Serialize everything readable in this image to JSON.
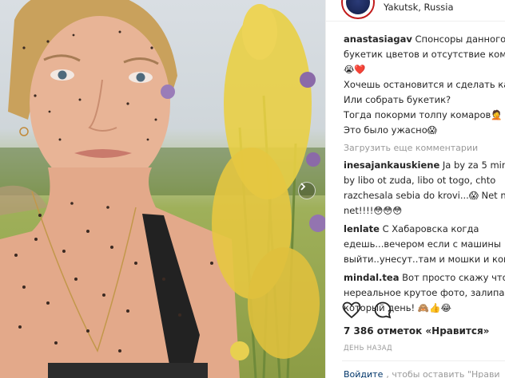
{
  "header": {
    "location": "Yakutsk, Russia"
  },
  "comments": [
    {
      "user": "anastasiagav",
      "text": "Спонсоры данного ф\nбукетик цветов и отсутствие комар\n😭❤️\nХочешь остановится и сделать кад\nИли собрать букетик?\nТогда покорми толпу комаров🤦 \nЭто было ужасно😱"
    }
  ],
  "load_more": "Загрузить еще комментарии",
  "replies": [
    {
      "user": "inesajankauskiene",
      "text": "Ja by za 5 min u\nby libo ot zuda, libo ot togo, chto\nrazchesala sebia do krovi...😱 Net n\nnet!!!!😳😳😳"
    },
    {
      "user": "lenlate",
      "text": "С Хабаровска когда\nедешь...вечером если с машины\nвыйти..унесут..там и мошки и кома"
    },
    {
      "user": "mindal.tea",
      "text": "Вот просто скажу что\nнереальное крутое фото, залипаю\nкоторый день! 🙈👍😂"
    }
  ],
  "actions": {
    "like_icon": "heart-outline-icon",
    "comment_icon": "comment-bubble-icon"
  },
  "likes_text": "7 386 отметок «Нравится»",
  "date_text": "ДЕНЬ НАЗАД",
  "login": {
    "link": "Войдите",
    "text": ", чтобы оставить \"Нрави"
  },
  "colors": {
    "text": "#262626",
    "muted": "#999999",
    "link": "#003569",
    "border": "#efefef"
  }
}
